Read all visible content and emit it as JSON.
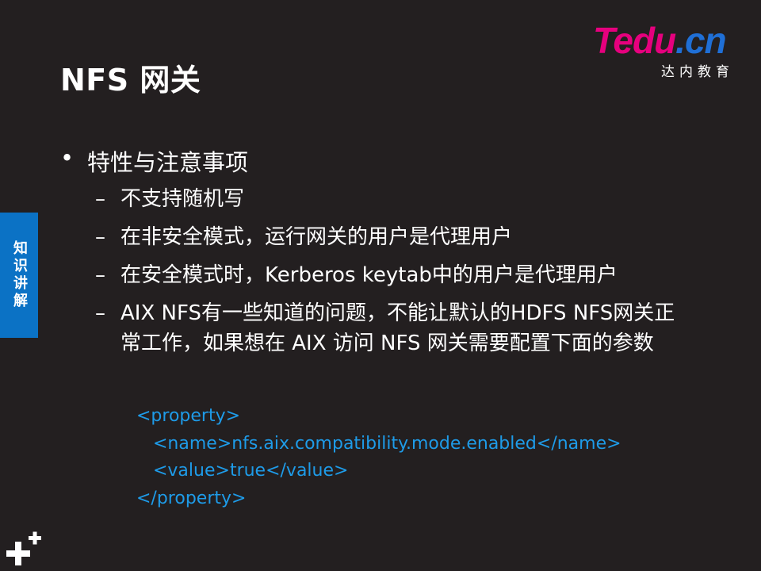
{
  "slide": {
    "title": "NFS 网关"
  },
  "logo": {
    "wordmark_main": "Tedu",
    "wordmark_suffix": ".cn",
    "tagline": "达内教育"
  },
  "side_tab": {
    "label": "知识讲解"
  },
  "content": {
    "heading": "特性与注意事项",
    "items": [
      "不支持随机写",
      "在非安全模式，运行网关的用户是代理用户",
      "在安全模式时，Kerberos keytab中的用户是代理用户",
      "AIX NFS有一些知道的问题，不能让默认的HDFS NFS网关正常工作，如果想在 AIX 访问 NFS 网关需要配置下面的参数"
    ],
    "bullet_glyph": "•",
    "dash_glyph": "–"
  },
  "code": {
    "line1": "<property>",
    "line2": "   <name>nfs.aix.compatibility.mode.enabled</name>",
    "line3": "   <value>true</value>",
    "line4": "</property>"
  },
  "colors": {
    "background": "#231f20",
    "accent_blue": "#0b72c5",
    "code_blue": "#1e9be8",
    "logo_pink": "#e6007e"
  },
  "icons": {
    "corner": "plus-icon"
  }
}
